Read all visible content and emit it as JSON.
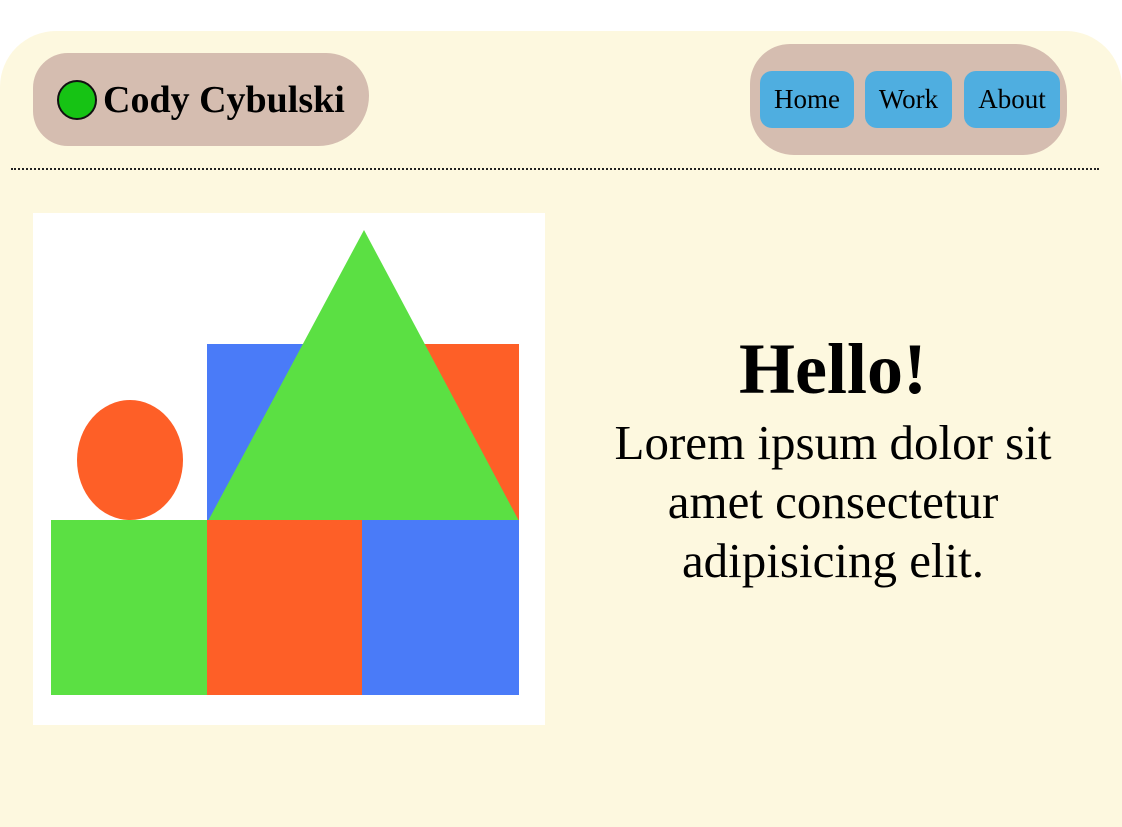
{
  "header": {
    "brand_name": "Cody Cybulski",
    "nav": [
      {
        "label": "Home"
      },
      {
        "label": "Work"
      },
      {
        "label": "About"
      }
    ]
  },
  "hero": {
    "title": "Hello!",
    "body": "Lorem ipsum dolor sit amet consectetur adipisicing elit."
  },
  "colors": {
    "page_background": "#fdf8df",
    "brand_pill": "#d5bdb0",
    "nav_button": "#4faee0",
    "logo_dot": "#16c314",
    "shape_green": "#5be043",
    "shape_orange": "#fe5f27",
    "shape_blue": "#4a7bf8"
  }
}
